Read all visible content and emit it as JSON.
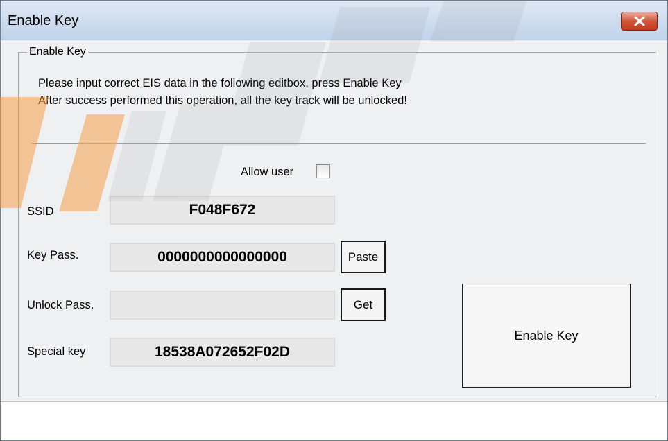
{
  "window": {
    "title": "Enable Key",
    "close_icon": "close-icon"
  },
  "group": {
    "legend": "Enable Key"
  },
  "instructions": {
    "line1": "Please input correct EIS data in the following editbox, press Enable Key",
    "line2": "After success performed this operation, all the key track will be unlocked!"
  },
  "allow_user": {
    "label": "Allow user",
    "checked": false
  },
  "fields": {
    "ssid": {
      "label": "SSID",
      "value": "F048F672"
    },
    "key_pass": {
      "label": "Key Pass.",
      "value": "0000000000000000"
    },
    "unlock_pass": {
      "label": "Unlock Pass.",
      "value": ""
    },
    "special_key": {
      "label": "Special key",
      "value": "18538A072652F02D"
    }
  },
  "buttons": {
    "paste": "Paste",
    "get": "Get",
    "enable_key": "Enable Key"
  },
  "colors": {
    "accent_watermark": "#f5a04a",
    "close_button": "#c9432a"
  }
}
